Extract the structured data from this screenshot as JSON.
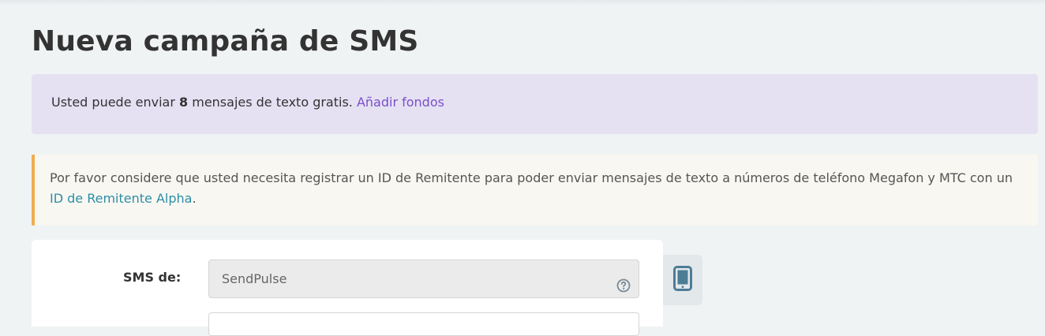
{
  "page": {
    "title": "Nueva campaña de SMS"
  },
  "free_sms_alert": {
    "text_before": "Usted puede enviar ",
    "count": "8",
    "text_after": " mensajes de texto gratis. ",
    "link": "Añadir fondos"
  },
  "sender_notice": {
    "text": "Por favor considere que usted necesita registrar un ID de Remitente para poder enviar mensajes de texto a números de teléfono Megafon y MTC con un ",
    "link": "ID de Remitente Alpha",
    "trailing": "."
  },
  "form": {
    "sender_label": "SMS de:",
    "sender_value": "SendPulse",
    "help_icon": "question-circle-icon"
  },
  "preview": {
    "icon": "mobile-phone-icon"
  },
  "colors": {
    "background": "#f0f3f4",
    "alert_purple_bg": "#e5e1f3",
    "purple_link": "#7b4fc9",
    "alert_orange_bg": "#f9f7f2",
    "alert_orange_border": "#efad4f",
    "teal_link": "#2b8fa6",
    "phone_icon": "#4c7d95"
  }
}
